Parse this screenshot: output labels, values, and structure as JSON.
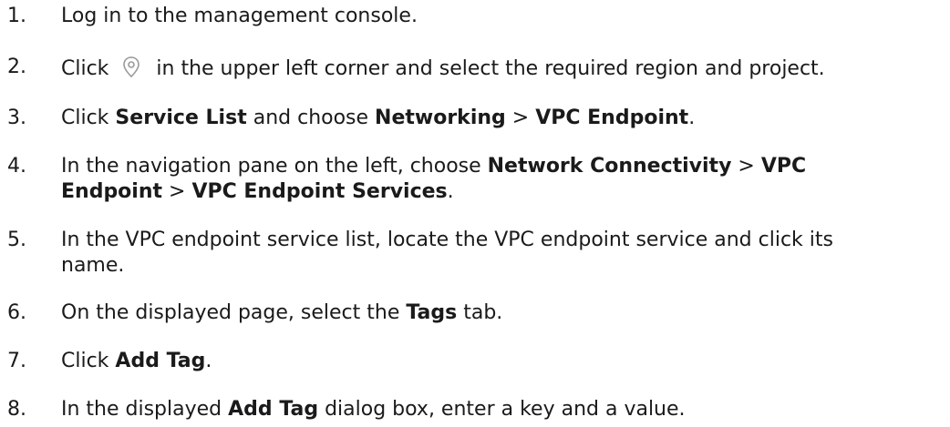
{
  "steps": [
    {
      "num": "1.",
      "parts": [
        {
          "t": "Log in to the management console."
        }
      ]
    },
    {
      "num": "2.",
      "parts": [
        {
          "t": "Click "
        },
        {
          "icon": "location-pin-icon"
        },
        {
          "t": " in the upper left corner and select the required region and project."
        }
      ]
    },
    {
      "num": "3.",
      "parts": [
        {
          "t": "Click "
        },
        {
          "b": "Service List"
        },
        {
          "t": " and choose "
        },
        {
          "b": "Networking"
        },
        {
          "t": " > "
        },
        {
          "b": "VPC Endpoint"
        },
        {
          "t": "."
        }
      ]
    },
    {
      "num": "4.",
      "parts": [
        {
          "t": "In the navigation pane on the left, choose "
        },
        {
          "b": "Network Connectivity"
        },
        {
          "t": " > "
        },
        {
          "b": "VPC"
        }
      ],
      "parts2": [
        {
          "b": "Endpoint"
        },
        {
          "t": " > "
        },
        {
          "b": "VPC Endpoint Services"
        },
        {
          "t": "."
        }
      ]
    },
    {
      "num": "5.",
      "parts": [
        {
          "t": "In the VPC endpoint service list, locate the VPC endpoint service and click its"
        }
      ],
      "parts2": [
        {
          "t": "name."
        }
      ]
    },
    {
      "num": "6.",
      "parts": [
        {
          "t": "On the displayed page, select the "
        },
        {
          "b": "Tags"
        },
        {
          "t": " tab."
        }
      ]
    },
    {
      "num": "7.",
      "parts": [
        {
          "t": "Click "
        },
        {
          "b": "Add Tag"
        },
        {
          "t": "."
        }
      ]
    },
    {
      "num": "8.",
      "parts": [
        {
          "t": "In the displayed "
        },
        {
          "b": "Add Tag"
        },
        {
          "t": " dialog box, enter a key and a value."
        }
      ]
    }
  ]
}
